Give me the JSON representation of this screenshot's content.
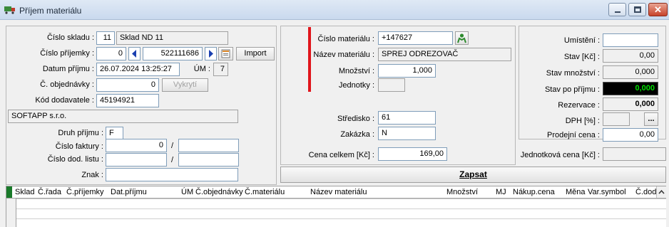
{
  "window": {
    "title": "Příjem materiálu"
  },
  "left": {
    "cislo_skladu": {
      "label": "Číslo skladu :",
      "value": "11",
      "name": "Sklad ND 11"
    },
    "cislo_prijemky": {
      "label": "Číslo příjemky :",
      "series": "0",
      "number": "522111686",
      "import_label": "Import"
    },
    "datum_prijmu": {
      "label": "Datum příjmu :",
      "value": "26.07.2024 13:25:27",
      "um_label": "ÚM :",
      "um_value": "7"
    },
    "cislo_objednavky": {
      "label": "Č. objednávky :",
      "value": "0",
      "vykryti_label": "Vykrytí"
    },
    "kod_dodavatele": {
      "label": "Kód dodavatele :",
      "value": "45194921"
    },
    "dodavatel_name": "SOFTAPP s.r.o.",
    "druh_prijmu": {
      "label": "Druh příjmu :",
      "value": "F"
    },
    "cislo_faktury": {
      "label": "Číslo faktury :",
      "value": "0",
      "sep": "/"
    },
    "cislo_dod_listu": {
      "label": "Číslo dod. listu :",
      "sep": "/"
    },
    "znak": {
      "label": "Znak :"
    }
  },
  "middle": {
    "cislo_materialu": {
      "label": "Číslo materiálu :",
      "value": "+147627"
    },
    "nazev_materialu": {
      "label": "Název materiálu :",
      "value": "SPREJ ODREZOVAČ"
    },
    "mnozstvi": {
      "label": "Množství :",
      "value": "1,000"
    },
    "jednotky": {
      "label": "Jednotky :",
      "value": ""
    },
    "stredisko": {
      "label": "Středisko :",
      "value": "61"
    },
    "zakazka": {
      "label": "Zakázka :",
      "value": "N"
    },
    "cena_celkem": {
      "label": "Cena celkem [Kč] :",
      "value": "169,00"
    },
    "zapsat_label": "Zapsat"
  },
  "right": {
    "umisteni": {
      "label": "Umístění :",
      "value": ""
    },
    "stav_kc": {
      "label": "Stav [Kč] :",
      "value": "0,00"
    },
    "stav_mnozstvi": {
      "label": "Stav množství :",
      "value": "0,000"
    },
    "stav_po_prijmu": {
      "label": "Stav po příjmu :",
      "value": "0,000"
    },
    "rezervace": {
      "label": "Rezervace :",
      "value": "0,000"
    },
    "dph": {
      "label": "DPH [%] :",
      "value": "",
      "button": "..."
    },
    "prodejni_cena": {
      "label": "Prodejní cena :",
      "value": "0,00"
    },
    "jednotkova_cena": {
      "label": "Jednotková cena [Kč] :",
      "value": ""
    }
  },
  "grid": {
    "headers": [
      "Sklad",
      "Č.řada",
      "Č.příjemky",
      "Dat.příjmu",
      "ÚM",
      "Č.objednávky",
      "Č.materiálu",
      "Název materiálu",
      "Množství",
      "MJ",
      "Nákup.cena",
      "Měna",
      "Var.symbol",
      "Č.dod.l"
    ]
  },
  "colors": {
    "accent_red": "#e0151c",
    "stav_po_prijmu_bg": "#000000",
    "stav_po_prijmu_fg": "#00e000"
  }
}
